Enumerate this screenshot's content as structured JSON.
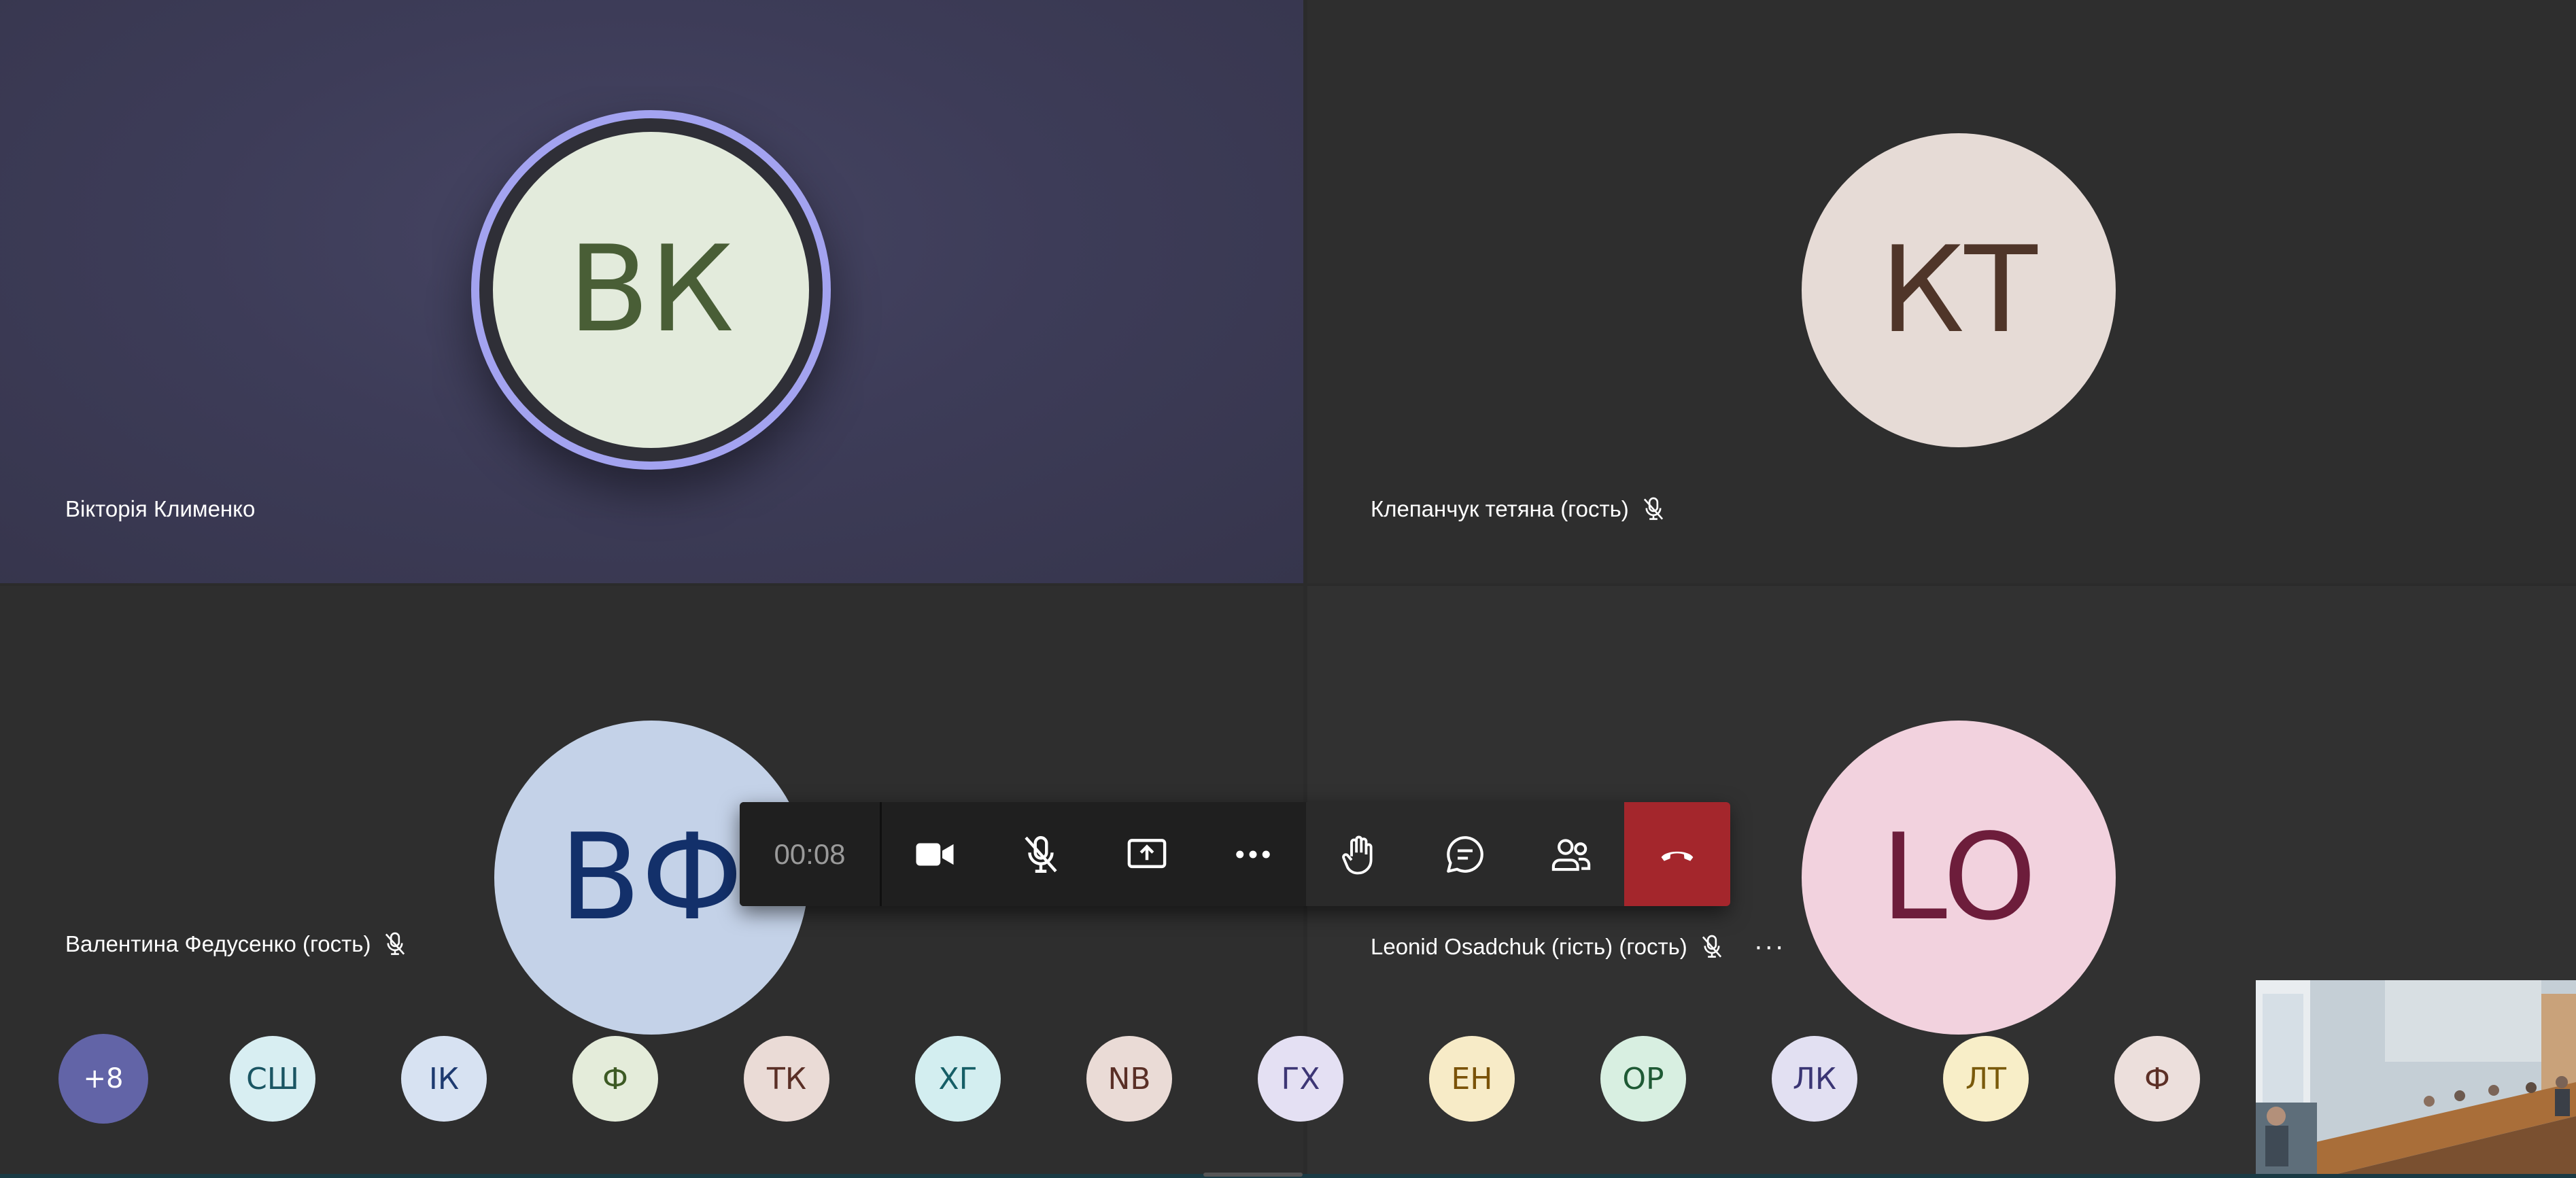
{
  "participants": [
    {
      "initials": "ВК",
      "name": "Вікторія Клименко",
      "muted": false,
      "avatar_bg": "#e3ebdc",
      "avatar_fg": "#495e36",
      "speaking": true
    },
    {
      "initials": "КТ",
      "name": "Клепанчук тетяна (гость)",
      "muted": true,
      "avatar_bg": "#e6dbd6",
      "avatar_fg": "#4f3529"
    },
    {
      "initials": "ВФ",
      "name": "Валентина Федусенко (гость)",
      "muted": true,
      "avatar_bg": "#c4d2e8",
      "avatar_fg": "#13306a"
    },
    {
      "initials": "LO",
      "name": "Leonid Osadchuk (гість) (гость)",
      "muted": true,
      "avatar_bg": "#f2d2de",
      "avatar_fg": "#6d1d3b"
    }
  ],
  "controls": {
    "timer": "00:08",
    "buttons": [
      {
        "icon": "camera-icon"
      },
      {
        "icon": "mic-off-icon"
      },
      {
        "icon": "share-screen-icon"
      },
      {
        "icon": "more-icon"
      },
      {
        "icon": "raise-hand-icon"
      },
      {
        "icon": "chat-icon"
      },
      {
        "icon": "people-icon"
      },
      {
        "icon": "hang-up-icon",
        "color": "#a4262c"
      }
    ]
  },
  "roster": {
    "more_label": "+8",
    "chips": [
      {
        "initials": "СШ",
        "bg": "#d8eef2",
        "fg": "#1a5563"
      },
      {
        "initials": "ІК",
        "bg": "#d7e2f2",
        "fg": "#1d3a70"
      },
      {
        "initials": "Ф",
        "bg": "#e4ecda",
        "fg": "#3d5a24"
      },
      {
        "initials": "ТК",
        "bg": "#eadbd6",
        "fg": "#5a2f26"
      },
      {
        "initials": "ХГ",
        "bg": "#d3eef0",
        "fg": "#155e66"
      },
      {
        "initials": "NB",
        "bg": "#eadbd6",
        "fg": "#5a2f26"
      },
      {
        "initials": "ГХ",
        "bg": "#e4e0f3",
        "fg": "#3d3675"
      },
      {
        "initials": "ЕН",
        "bg": "#f7ebc7",
        "fg": "#7a5208"
      },
      {
        "initials": "ОР",
        "bg": "#d8efe1",
        "fg": "#1f5a35"
      },
      {
        "initials": "ЛК",
        "bg": "#e2e0f2",
        "fg": "#3a3574"
      },
      {
        "initials": "ЛТ",
        "bg": "#f8eec8",
        "fg": "#7a5a0c"
      },
      {
        "initials": "Ф",
        "bg": "#ecdfdc",
        "fg": "#5c2f26"
      }
    ]
  }
}
